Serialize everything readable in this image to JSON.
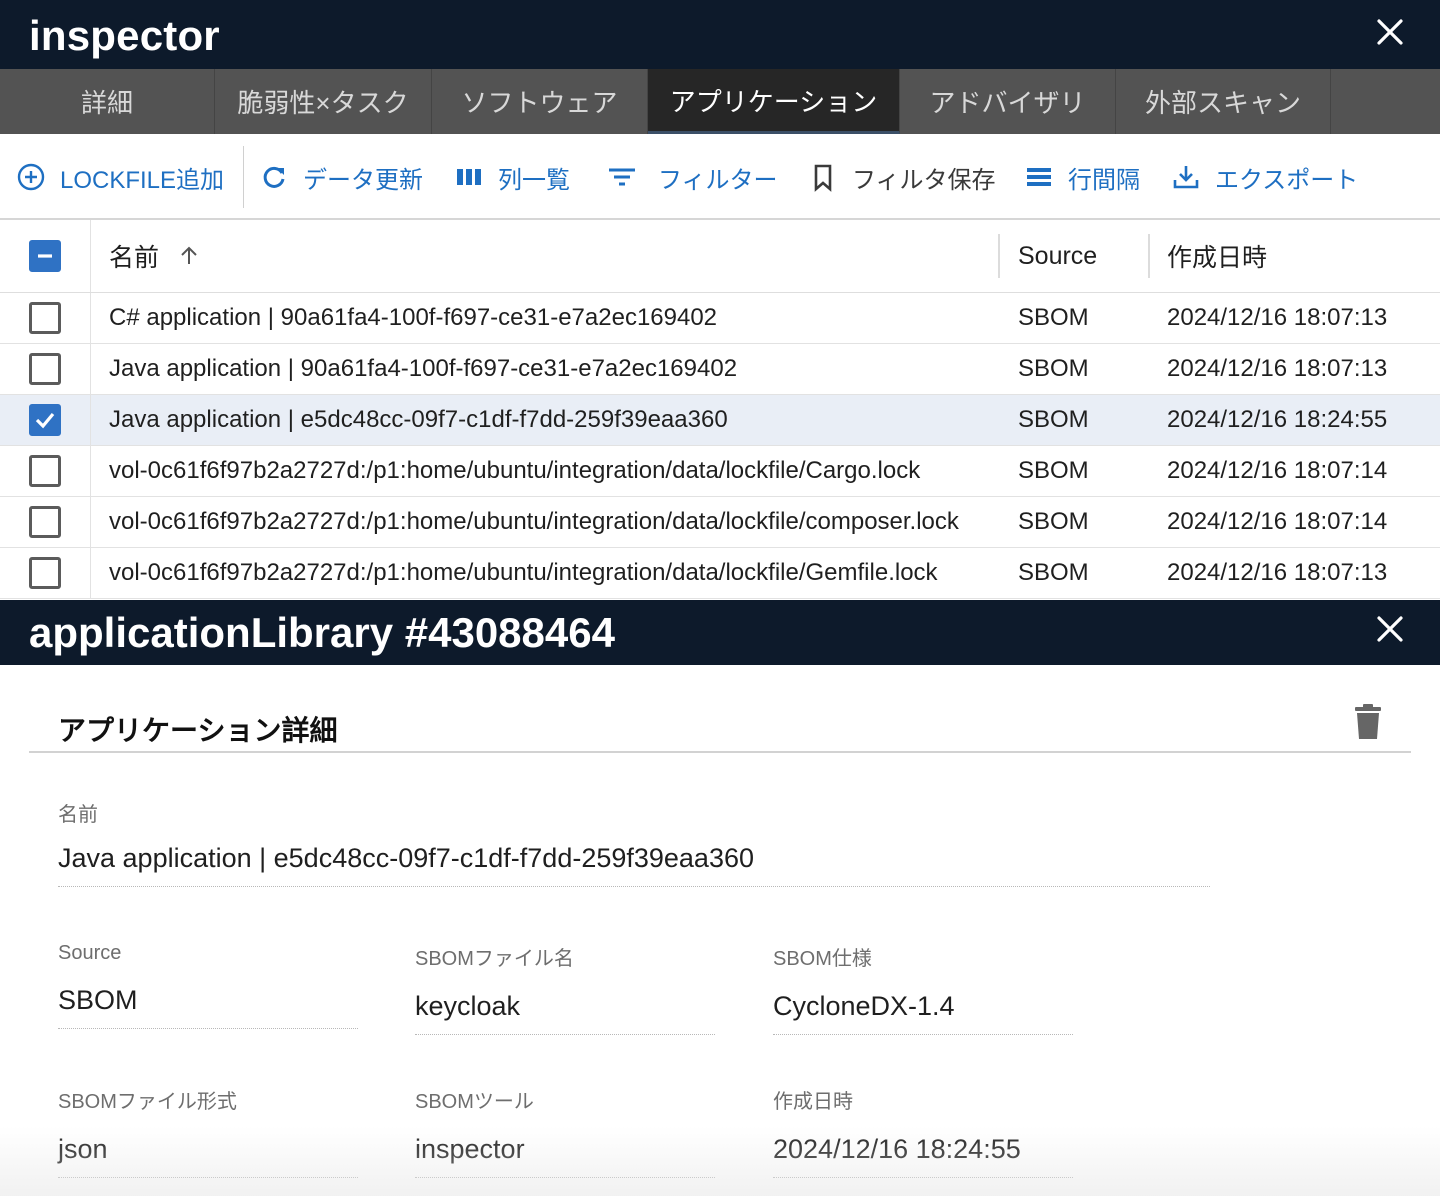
{
  "window": {
    "title": "inspector"
  },
  "tabs": [
    {
      "label": "詳細",
      "active": false
    },
    {
      "label": "脆弱性×タスク",
      "active": false
    },
    {
      "label": "ソフトウェア",
      "active": false
    },
    {
      "label": "アプリケーション",
      "active": true
    },
    {
      "label": "アドバイザリ",
      "active": false
    },
    {
      "label": "外部スキャン",
      "active": false
    }
  ],
  "toolbar": {
    "add_lockfile": "LOCKFILE追加",
    "refresh": "データ更新",
    "columns": "列一覧",
    "filter": "フィルター",
    "save_filter": "フィルタ保存",
    "density": "行間隔",
    "export": "エクスポート"
  },
  "grid": {
    "headers": {
      "name": "名前",
      "source": "Source",
      "created": "作成日時"
    },
    "sort": "asc",
    "rows": [
      {
        "name": "C# application | 90a61fa4-100f-f697-ce31-e7a2ec169402",
        "source": "SBOM",
        "created": "2024/12/16 18:07:13",
        "selected": false
      },
      {
        "name": "Java application | 90a61fa4-100f-f697-ce31-e7a2ec169402",
        "source": "SBOM",
        "created": "2024/12/16 18:07:13",
        "selected": false
      },
      {
        "name": "Java application | e5dc48cc-09f7-c1df-f7dd-259f39eaa360",
        "source": "SBOM",
        "created": "2024/12/16 18:24:55",
        "selected": true
      },
      {
        "name": "vol-0c61f6f97b2a2727d:/p1:home/ubuntu/integration/data/lockfile/Cargo.lock",
        "source": "SBOM",
        "created": "2024/12/16 18:07:14",
        "selected": false
      },
      {
        "name": "vol-0c61f6f97b2a2727d:/p1:home/ubuntu/integration/data/lockfile/composer.lock",
        "source": "SBOM",
        "created": "2024/12/16 18:07:14",
        "selected": false
      },
      {
        "name": "vol-0c61f6f97b2a2727d:/p1:home/ubuntu/integration/data/lockfile/Gemfile.lock",
        "source": "SBOM",
        "created": "2024/12/16 18:07:13",
        "selected": false
      }
    ]
  },
  "detail_window": {
    "title": "applicationLibrary #43088464"
  },
  "detail": {
    "section_title": "アプリケーション詳細",
    "name_label": "名前",
    "name_value": "Java application | e5dc48cc-09f7-c1df-f7dd-259f39eaa360",
    "fields": [
      {
        "label": "Source",
        "value": "SBOM"
      },
      {
        "label": "SBOMファイル名",
        "value": "keycloak"
      },
      {
        "label": "SBOM仕様",
        "value": "CycloneDX-1.4"
      },
      {
        "label": "SBOMファイル形式",
        "value": "json"
      },
      {
        "label": "SBOMツール",
        "value": "inspector"
      },
      {
        "label": "作成日時",
        "value": "2024/12/16 18:24:55"
      }
    ]
  },
  "colors": {
    "titlebar": "#0d1a2b",
    "tabbar": "#535353",
    "accent": "#1e6fc2",
    "selected_row": "#e9eef6"
  },
  "icons": [
    "close-icon",
    "add-circle-icon",
    "refresh-icon",
    "columns-icon",
    "filter-icon",
    "bookmark-icon",
    "density-icon",
    "download-icon",
    "sort-arrow-up-icon",
    "trash-icon"
  ]
}
